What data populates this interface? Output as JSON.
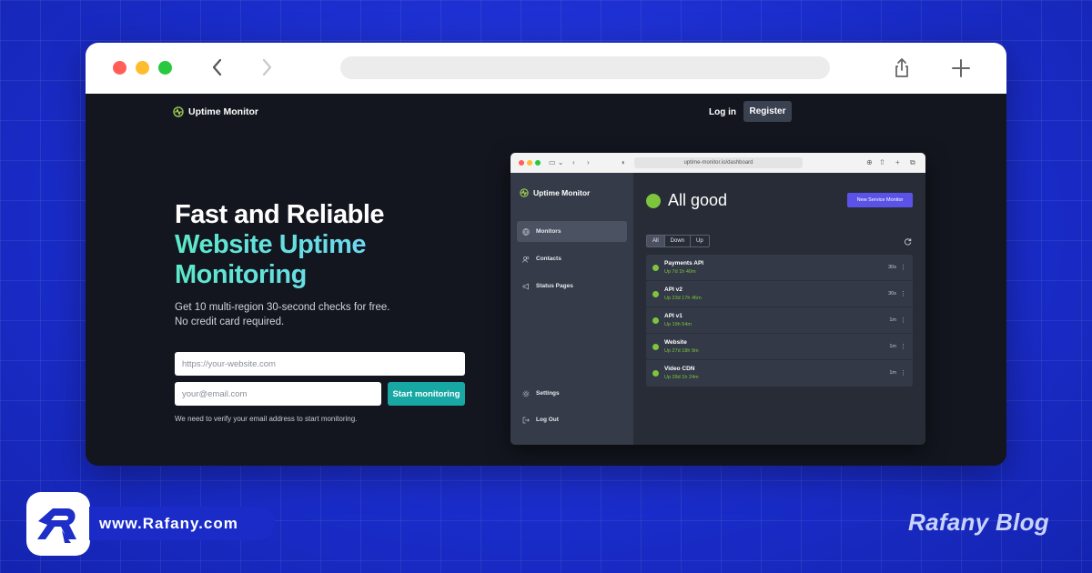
{
  "site": {
    "logo_text": "Uptime Monitor",
    "nav": {
      "login": "Log in",
      "register": "Register"
    },
    "hero": {
      "title_line1": "Fast and Reliable",
      "title_line2": "Website Uptime",
      "title_line3": "Monitoring",
      "subtitle_line1": "Get 10 multi-region 30-second checks for free.",
      "subtitle_line2": "No credit card required."
    },
    "form": {
      "url_placeholder": "https://your-website.com",
      "email_placeholder": "your@email.com",
      "submit_label": "Start monitoring",
      "note": "We need to verify your email address to start monitoring."
    }
  },
  "dashboard": {
    "url": "uptime-monitor.io/dashboard",
    "logo_text": "Uptime Monitor",
    "sidebar": {
      "items": [
        {
          "label": "Monitors",
          "icon": "globe-icon"
        },
        {
          "label": "Contacts",
          "icon": "contacts-icon"
        },
        {
          "label": "Status Pages",
          "icon": "megaphone-icon"
        }
      ],
      "settings": "Settings",
      "logout": "Log Out"
    },
    "status_text": "All good",
    "new_monitor_label": "New Service Monitor",
    "filters": [
      "All",
      "Down",
      "Up"
    ],
    "monitors": [
      {
        "name": "Payments API",
        "status": "Up 7d 1h 40m",
        "interval": "30s"
      },
      {
        "name": "API v2",
        "status": "Up 23d 17h 46m",
        "interval": "30s"
      },
      {
        "name": "API v1",
        "status": "Up 19h 54m",
        "interval": "1m"
      },
      {
        "name": "Website",
        "status": "Up 27d 18h 9m",
        "interval": "1m"
      },
      {
        "name": "Video CDN",
        "status": "Up 28d 1h 24m",
        "interval": "1m"
      }
    ]
  },
  "brand": {
    "url": "www.Rafany.com",
    "blog_name": "Rafany Blog"
  },
  "colors": {
    "background": "#1f31d6",
    "accent_teal": "#17a8a3",
    "status_green": "#7dc53c",
    "button_purple": "#5b53e8"
  }
}
